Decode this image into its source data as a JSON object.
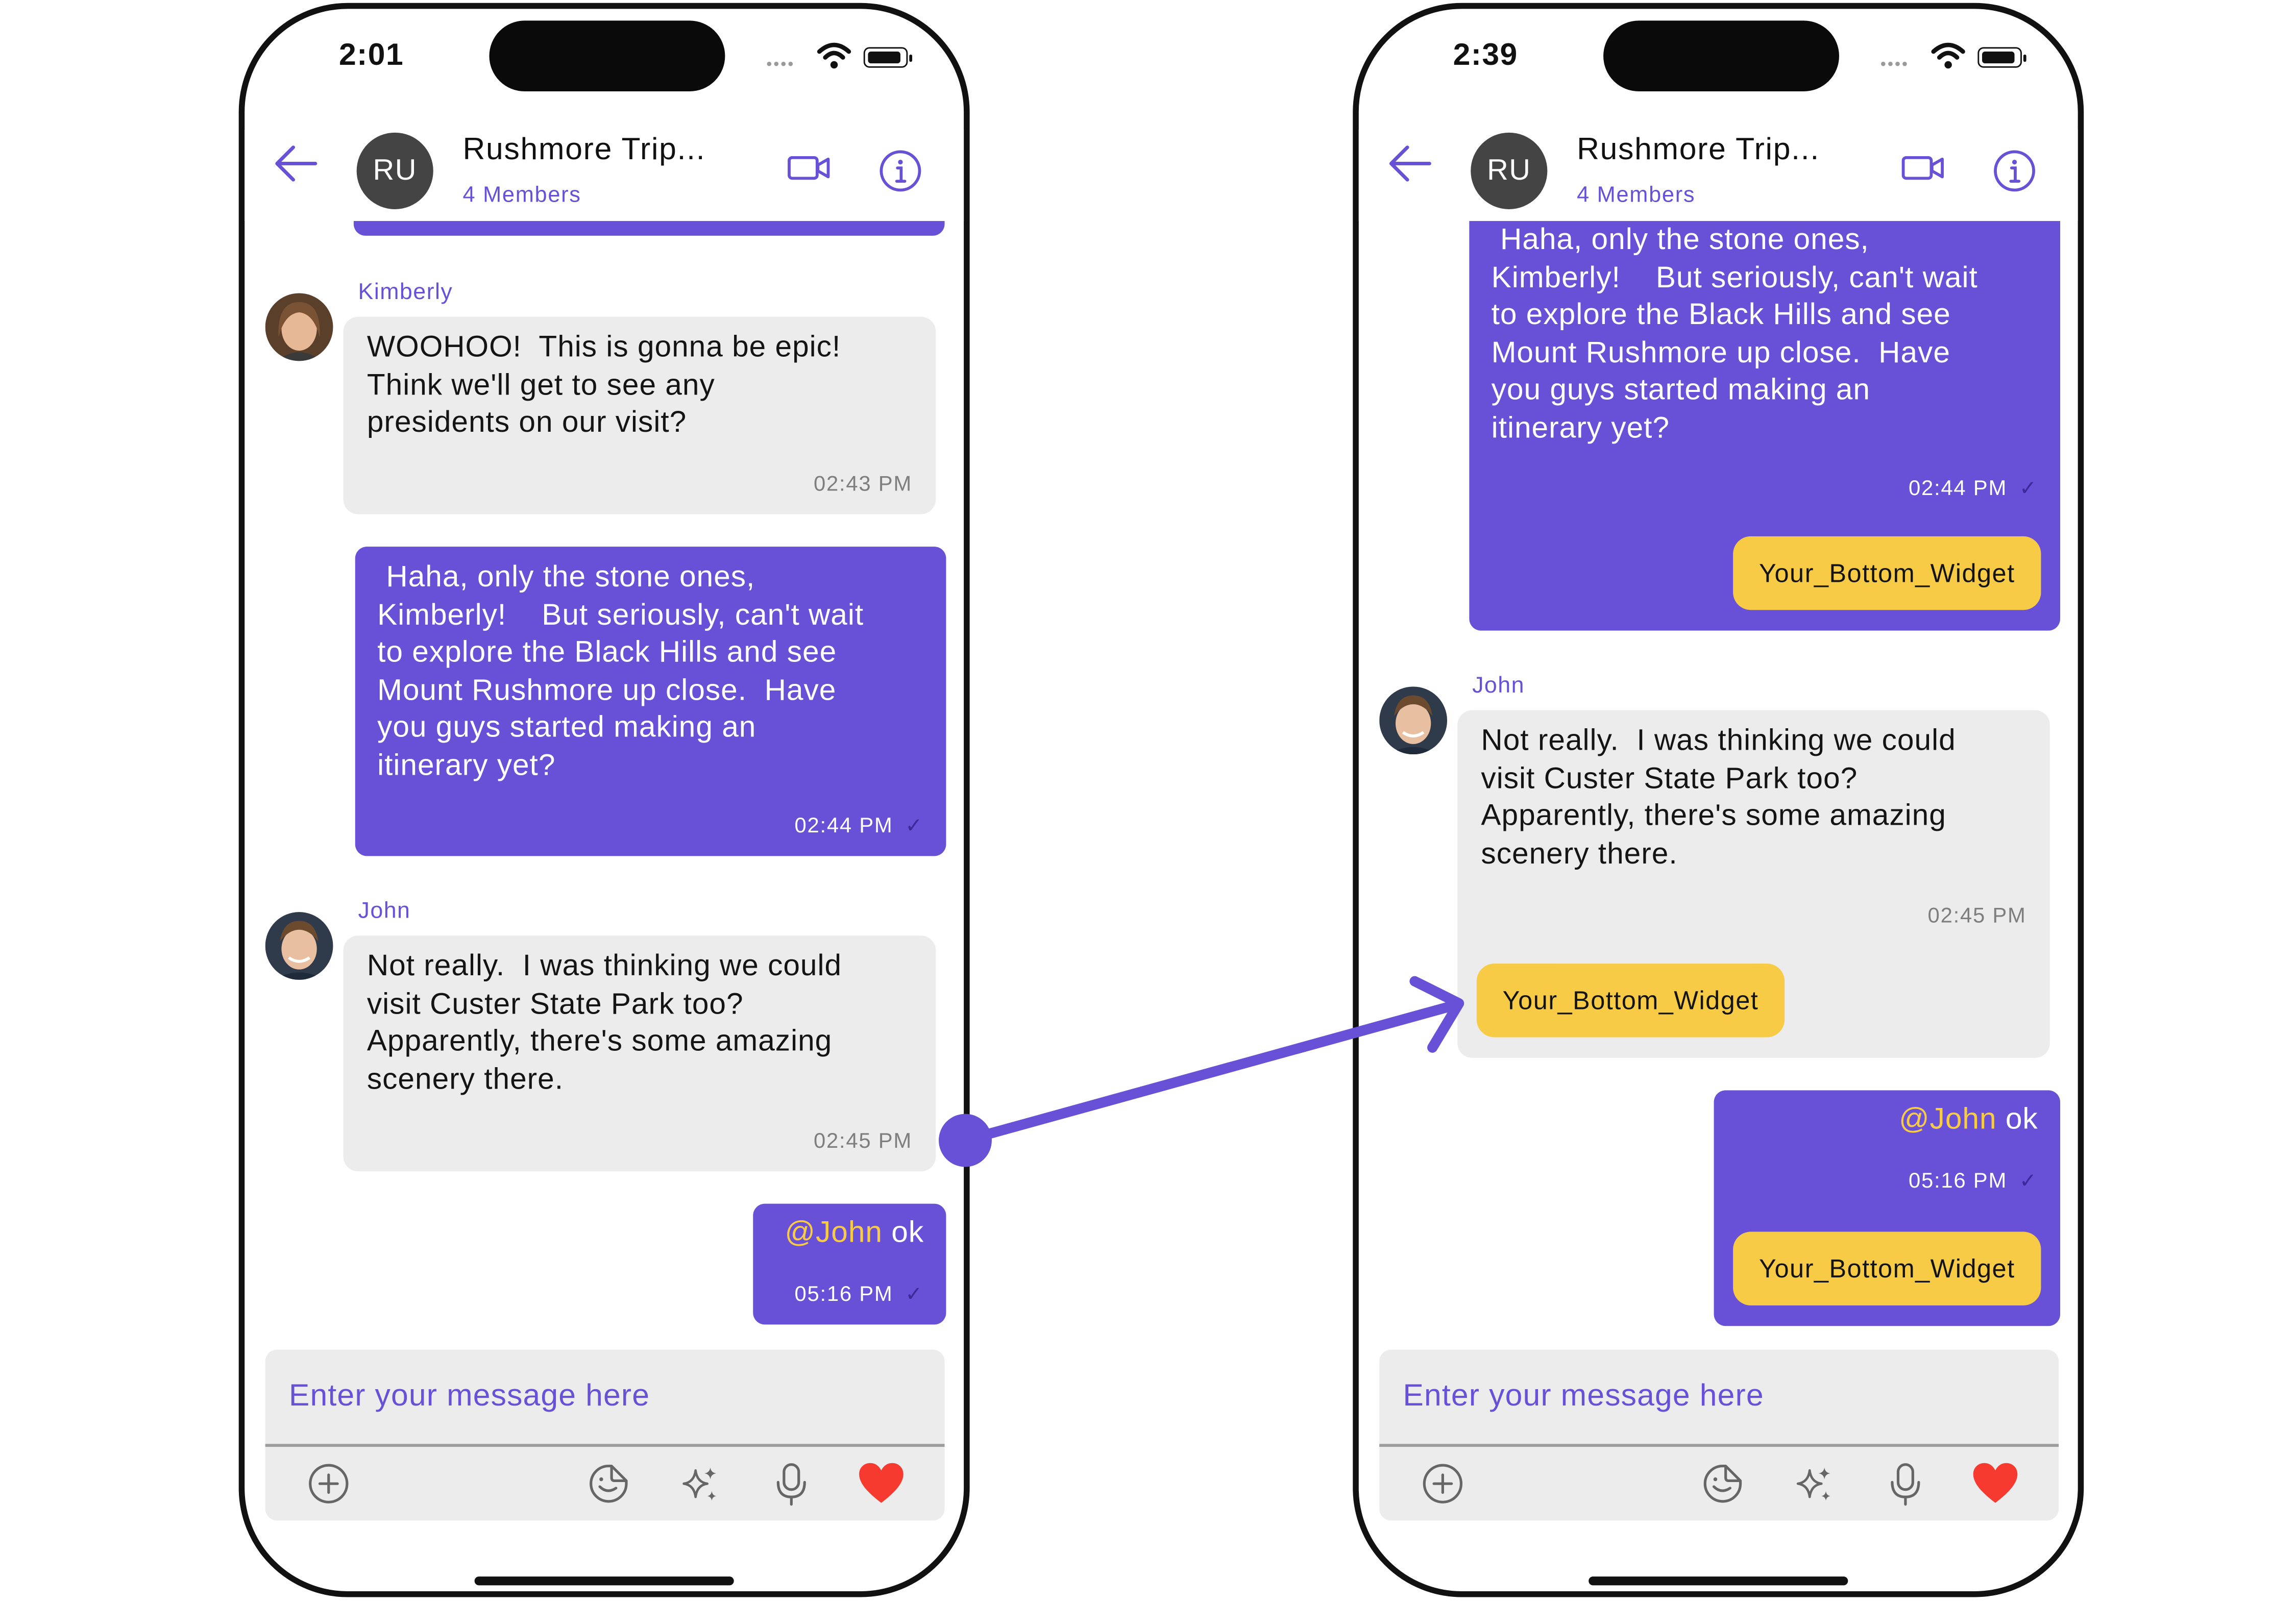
{
  "theme": {
    "accent": "#6851D6",
    "incoming_bubble": "#ECECEC",
    "highlight": "#F8CB46",
    "heart": "#F63A2F",
    "avatar_bg": "#444444"
  },
  "left_phone": {
    "status_time": "2:01",
    "header": {
      "avatar_initials": "RU",
      "title": "Rushmore Trip...",
      "subtitle": "4 Members"
    },
    "messages": {
      "kimberly": {
        "sender": "Kimberly",
        "text": "WOOHOO!  This is gonna be epic!\nThink we'll get to see any\npresidents on our visit?",
        "time": "02:43 PM"
      },
      "mine_long": {
        "text": " Haha, only the stone ones,\nKimberly!    But seriously, can't wait\nto explore the Black Hills and see\nMount Rushmore up close.  Have\nyou guys started making an\nitinerary yet?",
        "time": "02:44 PM",
        "tick": "✓"
      },
      "john": {
        "sender": "John",
        "text": "Not really.  I was thinking we could\nvisit Custer State Park too?\nApparently, there's some amazing\nscenery there.",
        "time": "02:45 PM"
      },
      "mine_short": {
        "mention": "@John",
        "text": " ok",
        "time": "05:16 PM",
        "tick": "✓"
      }
    },
    "composer": {
      "placeholder": "Enter your message here"
    }
  },
  "right_phone": {
    "status_time": "2:39",
    "header": {
      "avatar_initials": "RU",
      "title": "Rushmore Trip...",
      "subtitle": "4 Members"
    },
    "messages": {
      "mine_long": {
        "text": " Haha, only the stone ones,\nKimberly!    But seriously, can't wait\nto explore the Black Hills and see\nMount Rushmore up close.  Have\nyou guys started making an\nitinerary yet?",
        "time": "02:44 PM",
        "tick": "✓",
        "widget": "Your_Bottom_Widget"
      },
      "john": {
        "sender": "John",
        "text": "Not really.  I was thinking we could\nvisit Custer State Park too?\nApparently, there's some amazing\nscenery there.",
        "time": "02:45 PM",
        "widget": "Your_Bottom_Widget"
      },
      "mine_short": {
        "mention": "@John",
        "text": " ok",
        "time": "05:16 PM",
        "tick": "✓",
        "widget": "Your_Bottom_Widget"
      }
    },
    "composer": {
      "placeholder": "Enter your message here"
    }
  },
  "icons": [
    "back-arrow-icon",
    "video-call-icon",
    "info-icon",
    "add-icon",
    "sticker-icon",
    "ai-sparkle-icon",
    "microphone-icon",
    "heart-icon",
    "wifi-icon",
    "battery-icon"
  ]
}
